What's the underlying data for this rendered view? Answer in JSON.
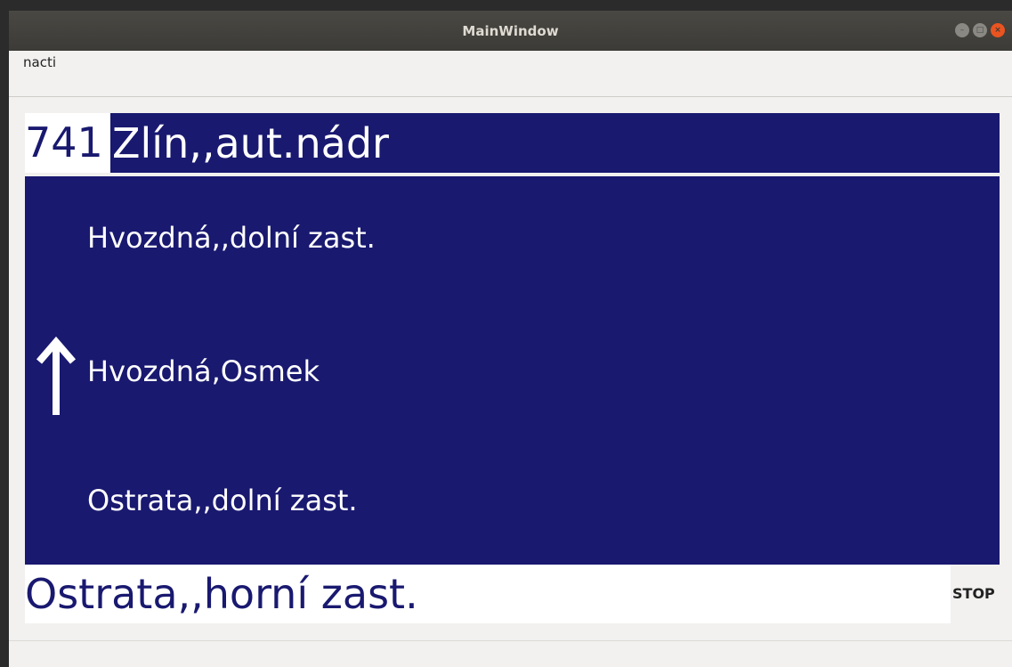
{
  "window": {
    "title": "MainWindow"
  },
  "menu": {
    "items": [
      {
        "label": "nacti"
      }
    ]
  },
  "header": {
    "line_number": "741",
    "destination": "Zlín,,aut.nádr"
  },
  "stops": [
    {
      "label": "Hvozdná,,dolní zast."
    },
    {
      "label": "Hvozdná,Osmek"
    },
    {
      "label": "Ostrata,,dolní zast."
    }
  ],
  "direction_icon": "arrow-up-icon",
  "current_stop": {
    "label": "Ostrata,,horní zast."
  },
  "stop_request": {
    "label": "STOP"
  },
  "colors": {
    "panel_background": "#191970",
    "panel_text": "#ffffff",
    "highlight_background": "#ffffff"
  }
}
